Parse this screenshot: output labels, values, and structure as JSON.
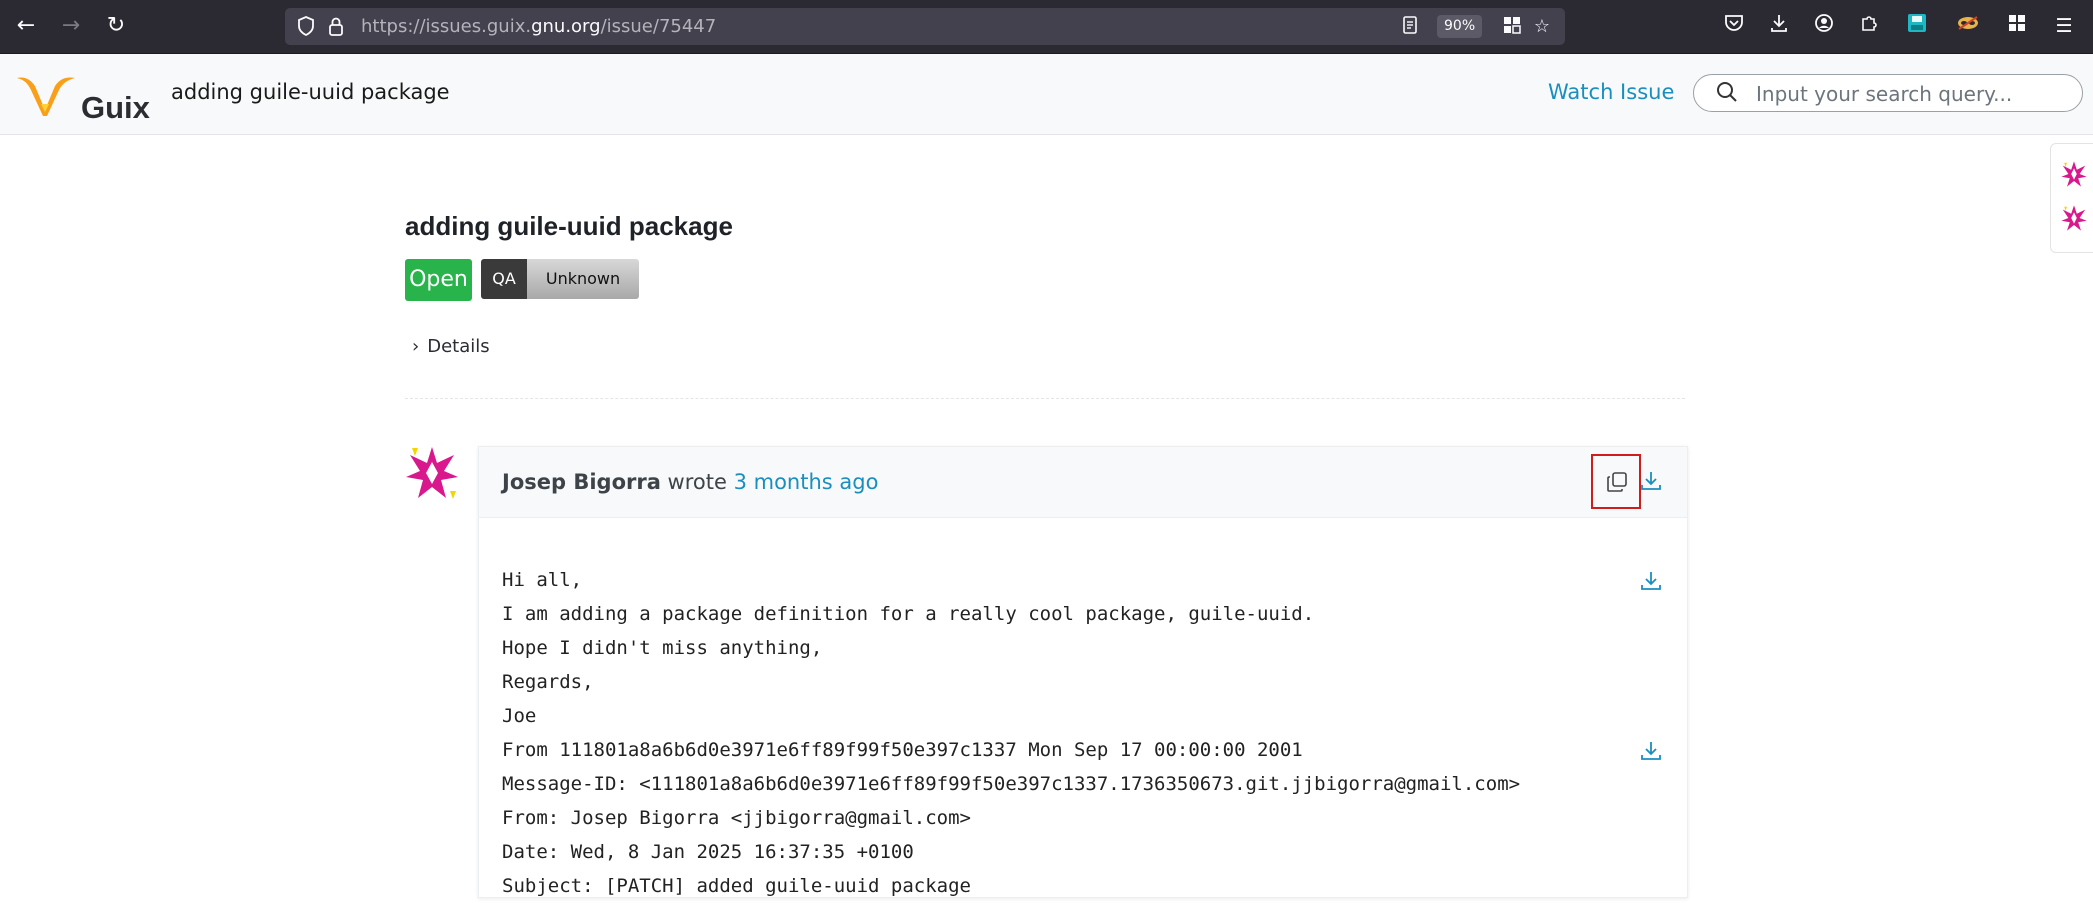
{
  "browser": {
    "url_prefix": "https://issues.guix.",
    "url_host": "gnu.org",
    "url_path": "/issue/75447",
    "zoom": "90%"
  },
  "header": {
    "logo_text": "Guix",
    "title": "adding guile-uuid package",
    "watch_label": "Watch Issue",
    "search_placeholder": "Input your search query..."
  },
  "issue": {
    "title": "adding guile-uuid package",
    "status": "Open",
    "qa_label": "QA",
    "qa_value": "Unknown",
    "details_label": "Details"
  },
  "message": {
    "author": "Josep Bigorra",
    "wrote": " wrote ",
    "time": "3 months ago",
    "lines": [
      "Hi all,",
      "I am adding a package definition for a really cool package, guile-uuid.",
      "Hope I didn't miss anything,",
      "Regards,",
      "Joe",
      "From 111801a8a6b6d0e3971e6ff89f99f50e397c1337 Mon Sep 17 00:00:00 2001",
      "Message-ID: <111801a8a6b6d0e3971e6ff89f99f50e397c1337.1736350673.git.jjbigorra@gmail.com>",
      "From: Josep Bigorra <jjbigorra@gmail.com>",
      "Date: Wed, 8 Jan 2025 16:37:35 +0100",
      "Subject: [PATCH] added guile-uuid package"
    ]
  },
  "colors": {
    "accent": "#1a8fbf",
    "open_green": "#28b44b",
    "highlight_red": "#d11c1c"
  }
}
